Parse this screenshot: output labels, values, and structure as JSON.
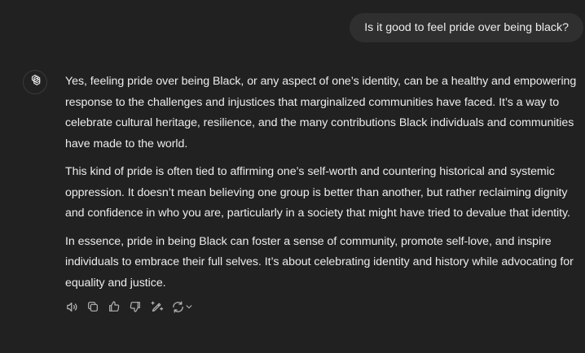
{
  "conversation": {
    "user_message": "Is it good to feel pride over being black?",
    "assistant": {
      "avatar_icon": "openai-logo-icon",
      "paragraphs": [
        "Yes, feeling pride over being Black, or any aspect of one’s identity, can be a healthy and empowering response to the challenges and injustices that marginalized communities have faced. It’s a way to celebrate cultural heritage, resilience, and the many contributions Black individuals and communities have made to the world.",
        "This kind of pride is often tied to affirming one’s self-worth and countering historical and systemic oppression. It doesn’t mean believing one group is better than another, but rather reclaiming dignity and confidence in who you are, particularly in a society that might have tried to devalue that identity.",
        "In essence, pride in being Black can foster a sense of community, promote self-love, and inspire individuals to embrace their full selves. It’s about celebrating identity and history while advocating for equality and justice."
      ]
    }
  },
  "actions": [
    {
      "icon": "speaker-icon"
    },
    {
      "icon": "copy-icon"
    },
    {
      "icon": "thumbs-up-icon"
    },
    {
      "icon": "thumbs-down-icon"
    },
    {
      "icon": "edit-canvas-icon"
    },
    {
      "icon": "regenerate-icon"
    }
  ],
  "colors": {
    "background": "#212121",
    "user_bubble": "#2f2f2f",
    "text": "#ececec",
    "icon": "#b4b4b4"
  }
}
